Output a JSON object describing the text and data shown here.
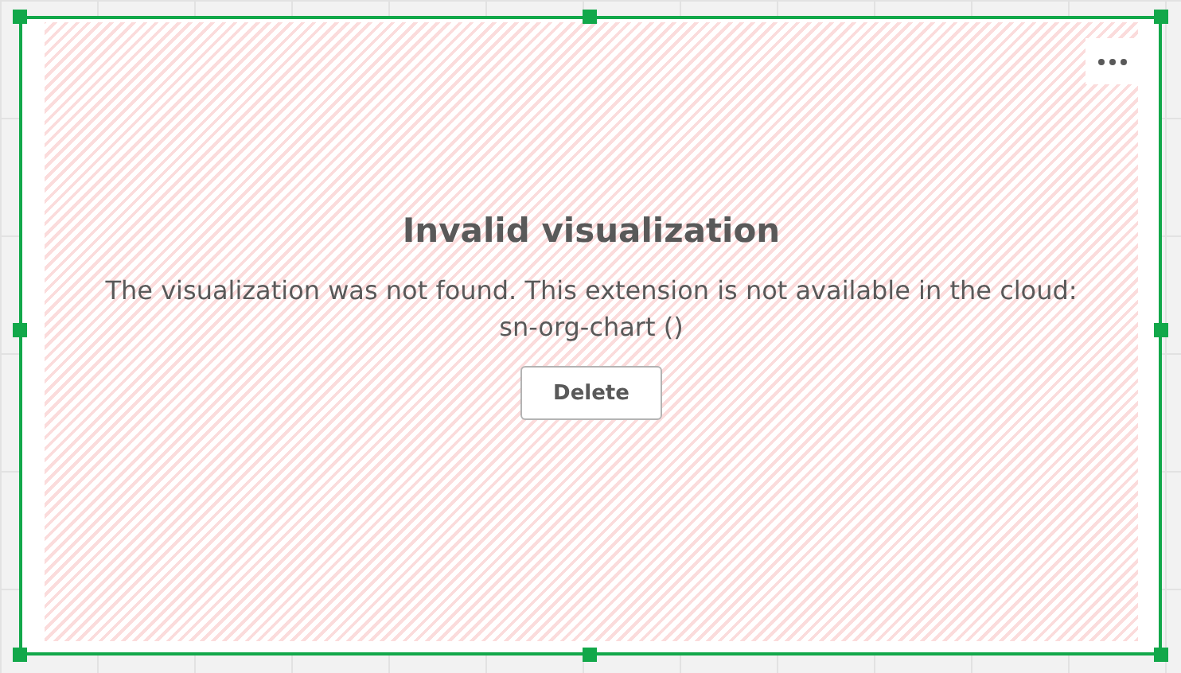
{
  "error": {
    "title": "Invalid visualization",
    "message": "The visualization was not found. This extension is not available in the cloud: sn-org-chart ()",
    "button": "Delete"
  }
}
